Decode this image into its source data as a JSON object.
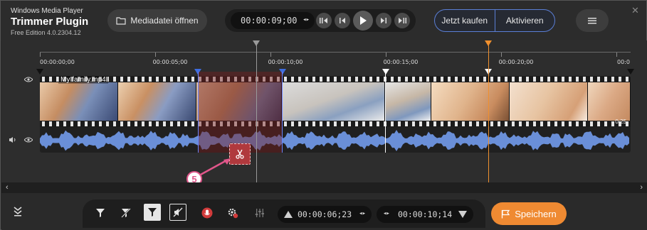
{
  "header": {
    "app_name": "Windows Media Player",
    "plugin_title": "Trimmer Plugin",
    "edition": "Free Edition 4.0.2304.12",
    "open_button": "Mediadatei öffnen",
    "current_time": "00:00:09;00",
    "buy_button": "Jetzt kaufen",
    "activate_button": "Aktivieren"
  },
  "ruler": {
    "labels": [
      "00:00:00;00",
      "00:00:05;00",
      "00:00:10;00",
      "00:00:15;00",
      "00:00:20;00",
      "00:0"
    ]
  },
  "clip": {
    "name": "My family.mp4",
    "end_label": "0:25"
  },
  "callout": {
    "number": "5"
  },
  "bottom": {
    "start_time": "00:00:06;23",
    "end_time": "00:00:10;14",
    "save_button": "Speichern"
  },
  "colors": {
    "accent_orange": "#ef8a32",
    "accent_blue": "#5b7fd6",
    "cut_red": "#b0393d",
    "waveform": "#6a8fd8"
  },
  "icons": [
    "folder-icon",
    "prev-frame-icon",
    "step-back-icon",
    "play-icon",
    "step-forward-icon",
    "next-frame-icon",
    "menu-icon",
    "close-icon",
    "eye-icon",
    "speaker-icon",
    "scissors-icon",
    "collapse-icon",
    "marker-in-icon",
    "marker-out-icon",
    "filter-icon",
    "mute-icon",
    "mic-icon",
    "settings-icon",
    "mixer-icon",
    "flag-icon"
  ]
}
